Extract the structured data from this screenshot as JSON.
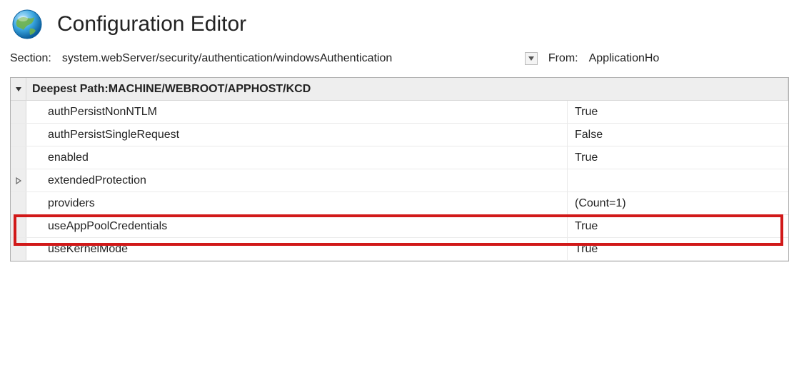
{
  "header": {
    "title": "Configuration Editor"
  },
  "toolbar": {
    "section_label": "Section:",
    "section_value": "system.webServer/security/authentication/windowsAuthentication",
    "from_label": "From:",
    "from_value": "ApplicationHo"
  },
  "grid": {
    "deepest_prefix": "Deepest Path: ",
    "deepest_path": "MACHINE/WEBROOT/APPHOST/KCD",
    "rows": [
      {
        "key": "authPersistNonNTLM",
        "value": "True"
      },
      {
        "key": "authPersistSingleRequest",
        "value": "False"
      },
      {
        "key": "enabled",
        "value": "True"
      },
      {
        "key": "extendedProtection",
        "value": ""
      },
      {
        "key": "providers",
        "value": "(Count=1)"
      },
      {
        "key": "useAppPoolCredentials",
        "value": "True"
      },
      {
        "key": "useKernelMode",
        "value": "True"
      }
    ]
  }
}
